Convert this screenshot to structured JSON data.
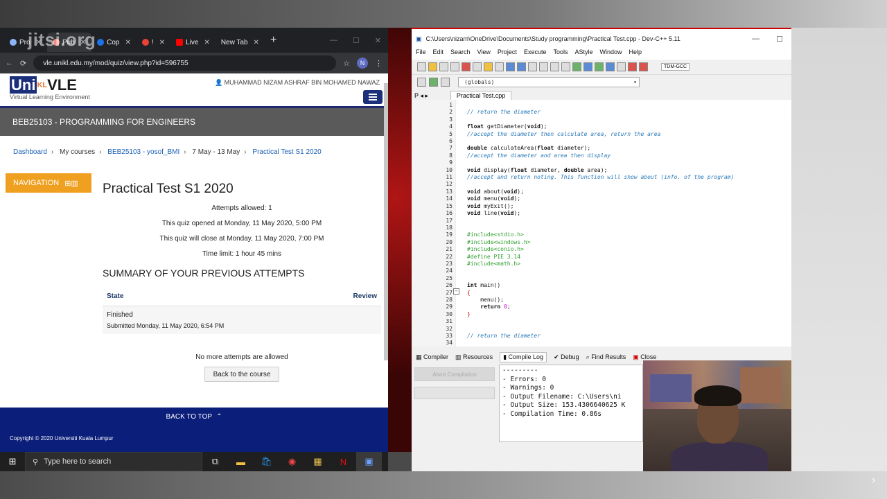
{
  "browser": {
    "tabs": [
      {
        "label": "Pro",
        "color": "#8ab4f8"
      },
      {
        "label": "Pub",
        "color": "#f28b82"
      },
      {
        "label": "Cop",
        "color": "#1a73e8"
      },
      {
        "label": "!",
        "color": "#ea4335"
      },
      {
        "label": "Live",
        "color": "#ff0000"
      },
      {
        "label": "New Tab",
        "color": "#9aa0a6"
      }
    ],
    "url": "vle.unikl.edu.my/mod/quiz/view.php?id=596755",
    "avatar_initial": "N",
    "watermark": "jitsi.org"
  },
  "vle": {
    "logo_uni": "Uni",
    "logo_kl": "KL",
    "logo_vle": "VLE",
    "logo_sub": "Virtual Learning Environment",
    "username": "MUHAMMAD NIZAM ASHRAF BIN MOHAMED NAWAZ",
    "course_title": "BEB25103 - PROGRAMMING FOR ENGINEERS",
    "breadcrumbs": [
      "Dashboard",
      "My courses",
      "BEB25103 - yosof_BMI",
      "7 May - 13 May",
      "Practical Test S1 2020"
    ],
    "navigation_label": "NAVIGATION",
    "quiz_title": "Practical Test S1 2020",
    "attempts_allowed": "Attempts allowed: 1",
    "opened": "This quiz opened at Monday, 11 May 2020, 5:00 PM",
    "closes": "This quiz will close at Monday, 11 May 2020, 7:00 PM",
    "time_limit": "Time limit: 1 hour 45 mins",
    "summary_heading": "SUMMARY OF YOUR PREVIOUS ATTEMPTS",
    "col_state": "State",
    "col_review": "Review",
    "attempt_state": "Finished",
    "attempt_submitted": "Submitted Monday, 11 May 2020, 6:54 PM",
    "no_more": "No more attempts are allowed",
    "back_course": "Back to the course",
    "back_top": "BACK TO TOP",
    "copyright": "Copyright © 2020 Universiti Kuala Lumpur"
  },
  "taskbar": {
    "search_placeholder": "Type here to search"
  },
  "devcpp": {
    "title": "C:\\Users\\nizam\\OneDrive\\Documents\\Study programming\\Practical Test.cpp - Dev-C++ 5.11",
    "menu": [
      "File",
      "Edit",
      "Search",
      "View",
      "Project",
      "Execute",
      "Tools",
      "AStyle",
      "Window",
      "Help"
    ],
    "compiler_label": "TDM-GCC",
    "scope": "(globals)",
    "file_tab": "Practical Test.cpp",
    "bottom_tabs": [
      "Compiler",
      "Resources",
      "Compile Log",
      "Debug",
      "Find Results",
      "Close"
    ],
    "abort_label": "Abort Compilation",
    "log_lines": [
      "---------",
      "- Errors: 0",
      "- Warnings: 0",
      "- Output Filename: C:\\Users\\ni",
      "- Output Size: 153.4306640625 K",
      "- Compilation Time: 0.86s"
    ]
  }
}
